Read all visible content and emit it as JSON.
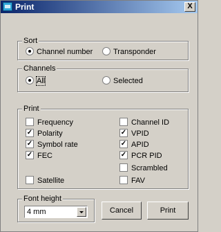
{
  "window": {
    "title": "Print",
    "close_glyph": "X"
  },
  "sort": {
    "legend": "Sort",
    "options": [
      {
        "label": "Channel number",
        "selected": true
      },
      {
        "label": "Transponder",
        "selected": false
      }
    ]
  },
  "channels": {
    "legend": "Channels",
    "options": [
      {
        "label": "All",
        "selected": true
      },
      {
        "label": "Selected",
        "selected": false
      }
    ]
  },
  "print": {
    "legend": "Print",
    "left": [
      {
        "label": "Frequency",
        "checked": false
      },
      {
        "label": "Polarity",
        "checked": true
      },
      {
        "label": "Symbol rate",
        "checked": true
      },
      {
        "label": "FEC",
        "checked": true
      },
      {
        "label": "Satellite",
        "checked": false
      }
    ],
    "right": [
      {
        "label": "Channel ID",
        "checked": false
      },
      {
        "label": "VPID",
        "checked": true
      },
      {
        "label": "APID",
        "checked": true
      },
      {
        "label": "PCR PID",
        "checked": true
      },
      {
        "label": "Scrambled",
        "checked": false
      },
      {
        "label": "FAV",
        "checked": false
      }
    ],
    "check_glyph": "✓"
  },
  "font_height": {
    "legend": "Font height",
    "selected": "4 mm"
  },
  "buttons": {
    "cancel": "Cancel",
    "print": "Print"
  }
}
